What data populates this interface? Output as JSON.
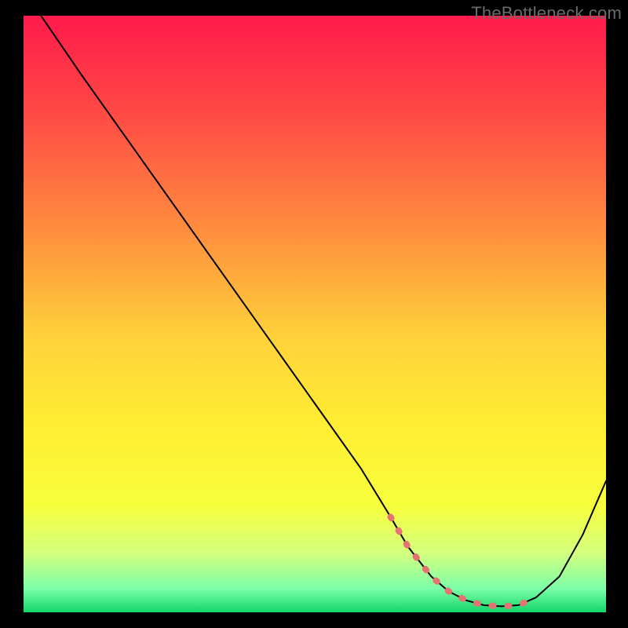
{
  "watermark": "TheBottleneck.com",
  "colors": {
    "curve": "#000000",
    "marker": "#e57373",
    "gradient_top": "#ff1a4b",
    "gradient_bottom": "#12d66a"
  },
  "chart_data": {
    "type": "line",
    "title": "",
    "xlabel": "",
    "ylabel": "",
    "xlim": [
      0,
      100
    ],
    "ylim": [
      0,
      100
    ],
    "grid": false,
    "series": [
      {
        "name": "bottleneck-curve",
        "x": [
          3,
          10,
          18,
          26,
          34,
          42,
          50,
          58,
          63,
          66,
          70,
          73,
          76,
          79,
          82,
          85,
          88,
          92,
          96,
          100
        ],
        "y": [
          100,
          90,
          79,
          68,
          57,
          46,
          35,
          24,
          16,
          11,
          6,
          3.5,
          2,
          1.2,
          1,
          1.2,
          2.5,
          6,
          13,
          22
        ]
      }
    ],
    "marker_region": {
      "x": [
        63,
        66,
        70,
        73,
        76,
        79,
        82,
        85,
        88
      ],
      "y": [
        16,
        11,
        6,
        3.5,
        2,
        1.2,
        1,
        1.2,
        2.5
      ]
    }
  }
}
